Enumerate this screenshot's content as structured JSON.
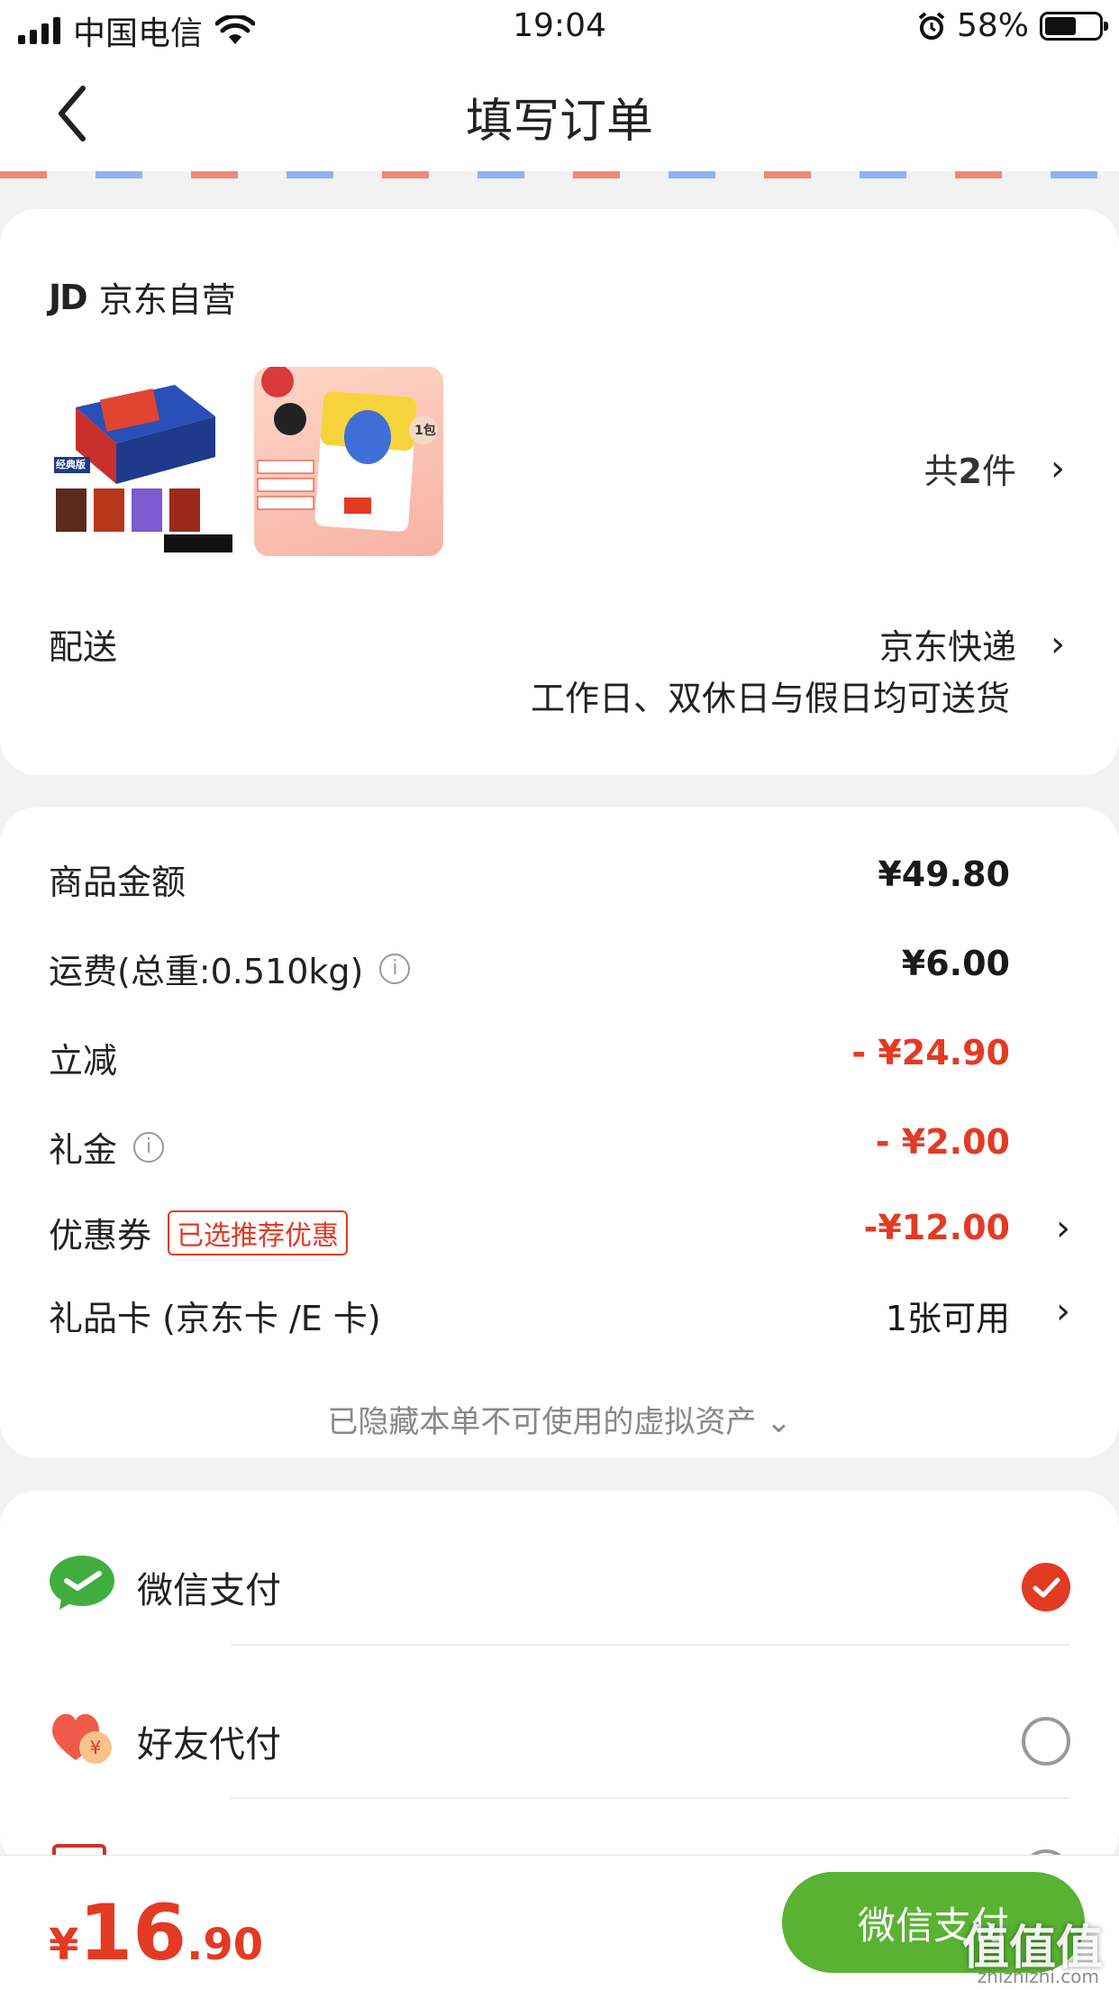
{
  "status_bar": {
    "carrier": "中国电信",
    "time": "19:04",
    "battery": "58%"
  },
  "header": {
    "title": "填写订单"
  },
  "shop": {
    "logo": "JD",
    "name": "京东自营",
    "product_count_prefix": "共",
    "product_count": "2",
    "product_count_suffix": "件",
    "product1_badge": "经典版",
    "product2_badge": "1包"
  },
  "delivery": {
    "label": "配送",
    "method": "京东快递",
    "note": "工作日、双休日与假日均可送货"
  },
  "price_details": {
    "goods_label": "商品金额",
    "goods_value": "¥49.80",
    "shipping_label": "运费(总重:0.510kg)",
    "shipping_value": "¥6.00",
    "discount_label": "立减",
    "discount_value": "- ¥24.90",
    "gift_money_label": "礼金",
    "gift_money_value": "- ¥2.00",
    "coupon_label": "优惠券",
    "coupon_tag": "已选推荐优惠",
    "coupon_value": "-¥12.00",
    "gift_card_label": "礼品卡 (京东卡 /E 卡)",
    "gift_card_value": "1张可用",
    "hidden_assets_text": "已隐藏本单不可使用的虚拟资产 ⌄"
  },
  "payment_methods": [
    {
      "label": "微信支付",
      "selected": true,
      "icon": "wechat-pay-icon"
    },
    {
      "label": "好友代付",
      "selected": false,
      "icon": "friend-pay-icon"
    }
  ],
  "footer": {
    "currency": "¥",
    "total_int": "16",
    "total_dec": ".90",
    "pay_button": "微信支付",
    "watermark": "值值值",
    "watermark_sub": "zhizhizhi.com"
  },
  "colors": {
    "accent": "#e33a24",
    "wechat_green": "#59b232"
  }
}
